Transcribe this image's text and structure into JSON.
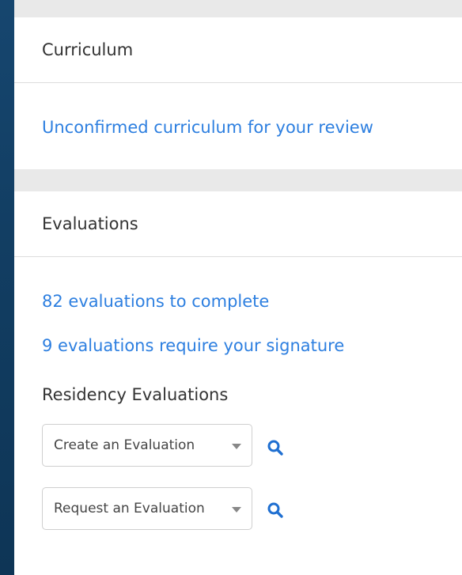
{
  "curriculum": {
    "header": "Curriculum",
    "link": "Unconfirmed curriculum for your review"
  },
  "evaluations": {
    "header": "Evaluations",
    "links": [
      "82 evaluations to complete",
      "9 evaluations require your signature"
    ],
    "section_title": "Residency Evaluations",
    "dropdowns": [
      {
        "selected": "Create an Evaluation",
        "icon": "search-icon"
      },
      {
        "selected": "Request an Evaluation",
        "icon": "search-icon"
      }
    ]
  },
  "colors": {
    "link": "#2d7fe0",
    "background": "#14426b",
    "search_icon": "#1f6fd1"
  }
}
